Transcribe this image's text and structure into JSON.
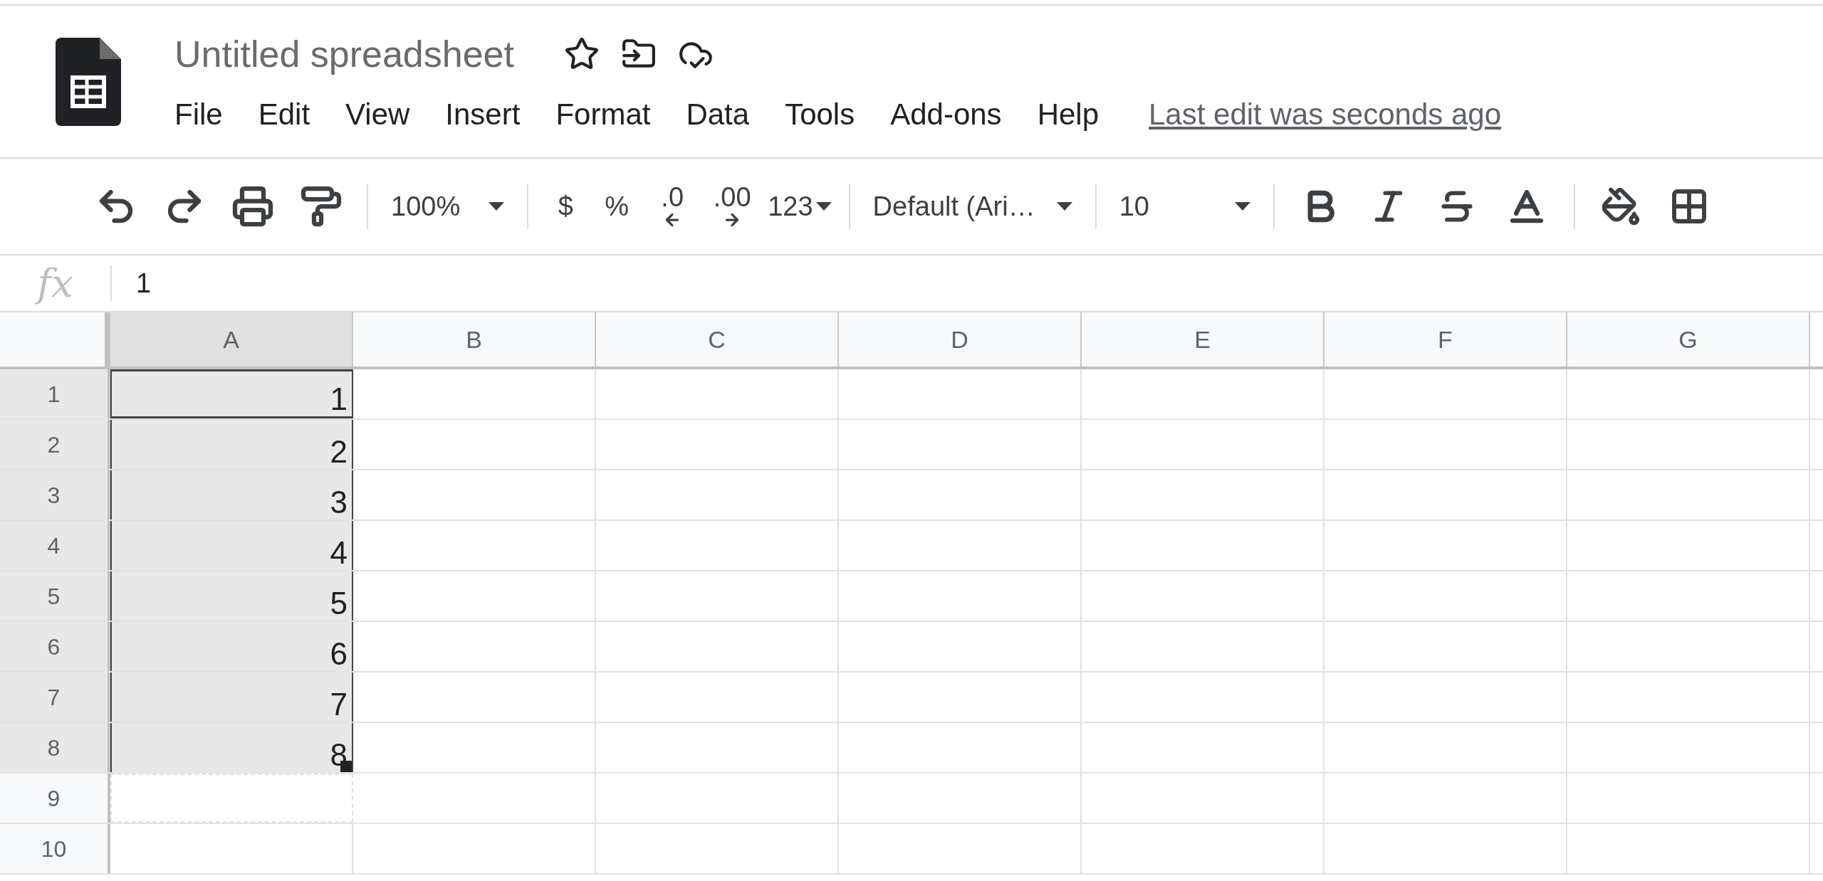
{
  "document": {
    "title": "Untitled spreadsheet"
  },
  "menu": [
    {
      "label": "File"
    },
    {
      "label": "Edit"
    },
    {
      "label": "View"
    },
    {
      "label": "Insert"
    },
    {
      "label": "Format"
    },
    {
      "label": "Data"
    },
    {
      "label": "Tools"
    },
    {
      "label": "Add-ons"
    },
    {
      "label": "Help"
    }
  ],
  "last_edit": "Last edit was seconds ago",
  "toolbar": {
    "zoom": "100%",
    "currency": "$",
    "percent": "%",
    "decrease_decimals": ".0",
    "increase_decimals": ".00",
    "number_format": "123",
    "font": "Default (Ari…",
    "font_size": "10"
  },
  "formula_bar": {
    "label": "fx",
    "value": "1"
  },
  "columns": [
    {
      "label": "A",
      "selected": true
    },
    {
      "label": "B",
      "selected": false
    },
    {
      "label": "C",
      "selected": false
    },
    {
      "label": "D",
      "selected": false
    },
    {
      "label": "E",
      "selected": false
    },
    {
      "label": "F",
      "selected": false
    },
    {
      "label": "G",
      "selected": false
    }
  ],
  "rows": [
    {
      "number": "1",
      "selected": true,
      "preview": false,
      "cells": [
        {
          "value": "1",
          "active": true
        }
      ]
    },
    {
      "number": "2",
      "selected": true,
      "preview": false,
      "cells": [
        {
          "value": "2",
          "active": false
        }
      ]
    },
    {
      "number": "3",
      "selected": true,
      "preview": false,
      "cells": [
        {
          "value": "3",
          "active": false
        }
      ]
    },
    {
      "number": "4",
      "selected": true,
      "preview": false,
      "cells": [
        {
          "value": "4",
          "active": false
        }
      ]
    },
    {
      "number": "5",
      "selected": true,
      "preview": false,
      "cells": [
        {
          "value": "5",
          "active": false
        }
      ]
    },
    {
      "number": "6",
      "selected": true,
      "preview": false,
      "cells": [
        {
          "value": "6",
          "active": false
        }
      ]
    },
    {
      "number": "7",
      "selected": true,
      "preview": false,
      "cells": [
        {
          "value": "7",
          "active": false
        }
      ]
    },
    {
      "number": "8",
      "selected": true,
      "preview": false,
      "cells": [
        {
          "value": "8",
          "active": false
        }
      ]
    },
    {
      "number": "9",
      "selected": false,
      "preview": true
    },
    {
      "number": "10",
      "selected": false,
      "preview": false
    }
  ]
}
